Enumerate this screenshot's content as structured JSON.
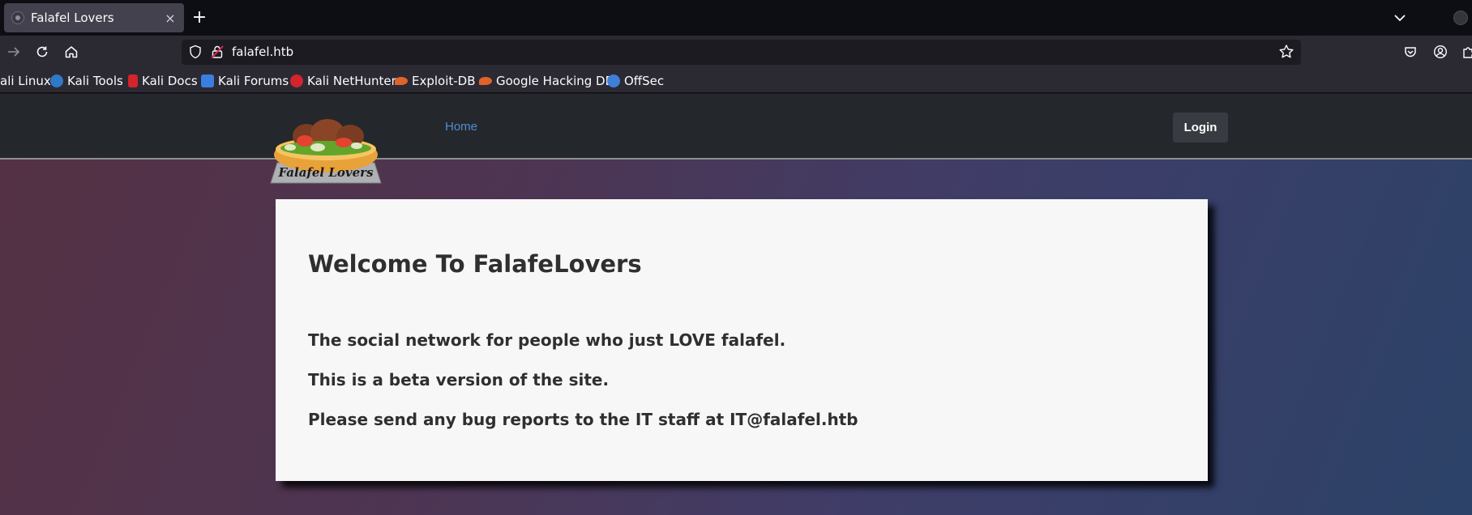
{
  "browser": {
    "tab": {
      "title": "Falafel Lovers",
      "close": "×"
    },
    "new_tab": "+",
    "url": "falafel.htb",
    "bookmarks": [
      {
        "label": "ali Linux",
        "icon": "kali-icon",
        "color": "#2f79c7"
      },
      {
        "label": "Kali Tools",
        "icon": "kali-tools-icon",
        "color": "#2f79c7"
      },
      {
        "label": "Kali Docs",
        "icon": "kali-docs-icon",
        "color": "#d4242c"
      },
      {
        "label": "Kali Forums",
        "icon": "kali-forums-icon",
        "color": "#3a7ee0"
      },
      {
        "label": "Kali NetHunter",
        "icon": "nethunter-icon",
        "color": "#d4242c"
      },
      {
        "label": "Exploit-DB",
        "icon": "exploit-db-icon",
        "color": "#e0642a"
      },
      {
        "label": "Google Hacking DB",
        "icon": "ghdb-icon",
        "color": "#e0642a"
      },
      {
        "label": "OffSec",
        "icon": "offsec-icon",
        "color": "#3f7fd9"
      }
    ]
  },
  "site": {
    "logo_text": "Falafel Lovers",
    "nav": {
      "home": "Home",
      "login": "Login"
    },
    "accent": "#4f8ed3"
  },
  "content": {
    "title": "Welcome To FalafeLovers",
    "lines": [
      "The social network for people who just LOVE falafel.",
      "This is a beta version of the site.",
      "Please send any bug reports to the IT staff at IT@falafel.htb"
    ]
  }
}
